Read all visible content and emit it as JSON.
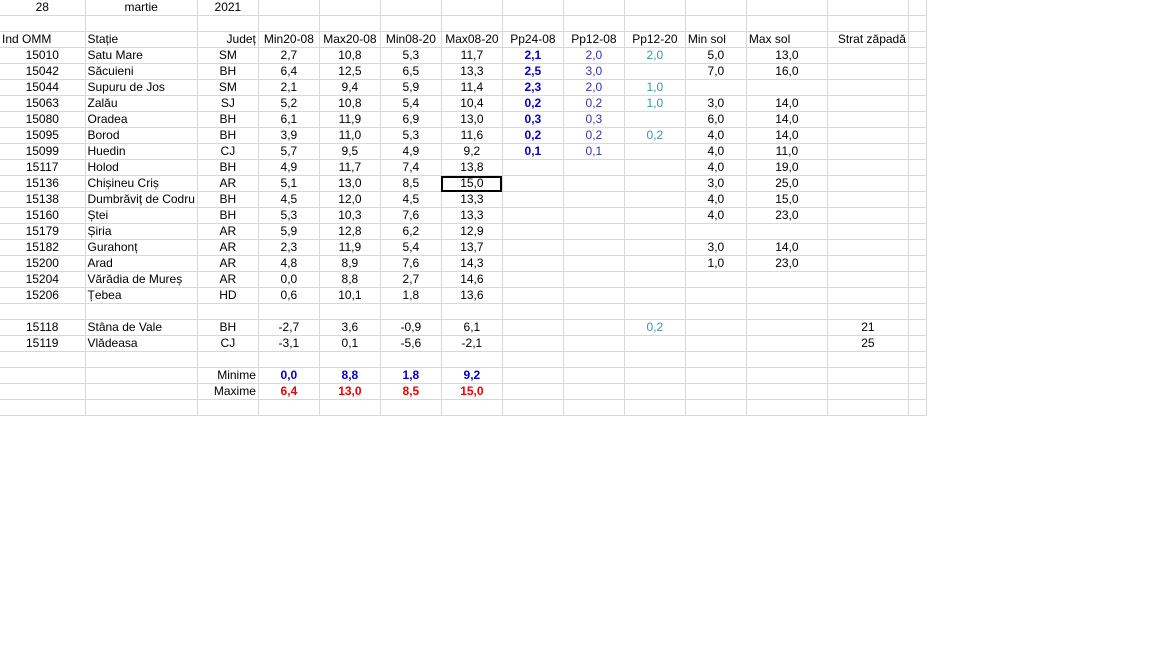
{
  "date": {
    "day": "28",
    "month": "martie",
    "year": "2021"
  },
  "headers": [
    "Ind OMM",
    "Stație",
    "Județ",
    "Min20-08",
    "Max20-08",
    "Min08-20",
    "Max08-20",
    "Pp24-08",
    "Pp12-08",
    "Pp12-20",
    "Min sol",
    "Max sol",
    "Strat zăpadă"
  ],
  "rows": [
    [
      "15010",
      "Satu Mare",
      "SM",
      "2,7",
      "10,8",
      "5,3",
      "11,7",
      "2,1",
      "2,0",
      "2,0",
      "5,0",
      "13,0",
      ""
    ],
    [
      "15042",
      "Săcuieni",
      "BH",
      "6,4",
      "12,5",
      "6,5",
      "13,3",
      "2,5",
      "3,0",
      "",
      "7,0",
      "16,0",
      ""
    ],
    [
      "15044",
      "Supuru de Jos",
      "SM",
      "2,1",
      "9,4",
      "5,9",
      "11,4",
      "2,3",
      "2,0",
      "1,0",
      "",
      "",
      ""
    ],
    [
      "15063",
      "Zalău",
      "SJ",
      "5,2",
      "10,8",
      "5,4",
      "10,4",
      "0,2",
      "0,2",
      "1,0",
      "3,0",
      "14,0",
      ""
    ],
    [
      "15080",
      "Oradea",
      "BH",
      "6,1",
      "11,9",
      "6,9",
      "13,0",
      "0,3",
      "0,3",
      "",
      "6,0",
      "14,0",
      ""
    ],
    [
      "15095",
      "Borod",
      "BH",
      "3,9",
      "11,0",
      "5,3",
      "11,6",
      "0,2",
      "0,2",
      "0,2",
      "4,0",
      "14,0",
      ""
    ],
    [
      "15099",
      "Huedin",
      "CJ",
      "5,7",
      "9,5",
      "4,9",
      "9,2",
      "0,1",
      "0,1",
      "",
      "4,0",
      "11,0",
      ""
    ],
    [
      "15117",
      "Holod",
      "BH",
      "4,9",
      "11,7",
      "7,4",
      "13,8",
      "",
      "",
      "",
      "4,0",
      "19,0",
      ""
    ],
    [
      "15136",
      "Chișineu   Criș",
      "AR",
      "5,1",
      "13,0",
      "8,5",
      "15,0",
      "",
      "",
      "",
      "3,0",
      "25,0",
      ""
    ],
    [
      "15138",
      "Dumbrăviț  de Codru",
      "BH",
      "4,5",
      "12,0",
      "4,5",
      "13,3",
      "",
      "",
      "",
      "4,0",
      "15,0",
      ""
    ],
    [
      "15160",
      "Ștei",
      "BH",
      "5,3",
      "10,3",
      "7,6",
      "13,3",
      "",
      "",
      "",
      "4,0",
      "23,0",
      ""
    ],
    [
      "15179",
      "Șiria",
      "AR",
      "5,9",
      "12,8",
      "6,2",
      "12,9",
      "",
      "",
      "",
      "",
      "",
      ""
    ],
    [
      "15182",
      "Gurahonț",
      "AR",
      "2,3",
      "11,9",
      "5,4",
      "13,7",
      "",
      "",
      "",
      "3,0",
      "14,0",
      ""
    ],
    [
      "15200",
      "Arad",
      "AR",
      "4,8",
      "8,9",
      "7,6",
      "14,3",
      "",
      "",
      "",
      "1,0",
      "23,0",
      ""
    ],
    [
      "15204",
      "Vărădia de Mureș",
      "AR",
      "0,0",
      "8,8",
      "2,7",
      "14,6",
      "",
      "",
      "",
      "",
      "",
      ""
    ],
    [
      "15206",
      "Țebea",
      "HD",
      "0,6",
      "10,1",
      "1,8",
      "13,6",
      "",
      "",
      "",
      "",
      "",
      ""
    ]
  ],
  "mountain_rows": [
    [
      "15118",
      "Stâna de Vale",
      "BH",
      "-2,7",
      "3,6",
      "-0,9",
      "6,1",
      "",
      "",
      "0,2",
      "",
      "",
      "21"
    ],
    [
      "15119",
      "Vlădeasa",
      "CJ",
      "-3,1",
      "0,1",
      "-5,6",
      "-2,1",
      "",
      "",
      "",
      "",
      "",
      "25"
    ]
  ],
  "summary": {
    "min_label": "Minime",
    "max_label": "Maxime",
    "min_values": [
      "0,0",
      "8,8",
      "1,8",
      "9,2"
    ],
    "max_values": [
      "6,4",
      "13,0",
      "8,5",
      "15,0"
    ]
  },
  "colors": {
    "pp24": "#0000cc",
    "pp12_08": "#3333aa",
    "pp12_20": "#339999",
    "max_row": "#ee0000",
    "gridline": "#d8d8d8"
  }
}
